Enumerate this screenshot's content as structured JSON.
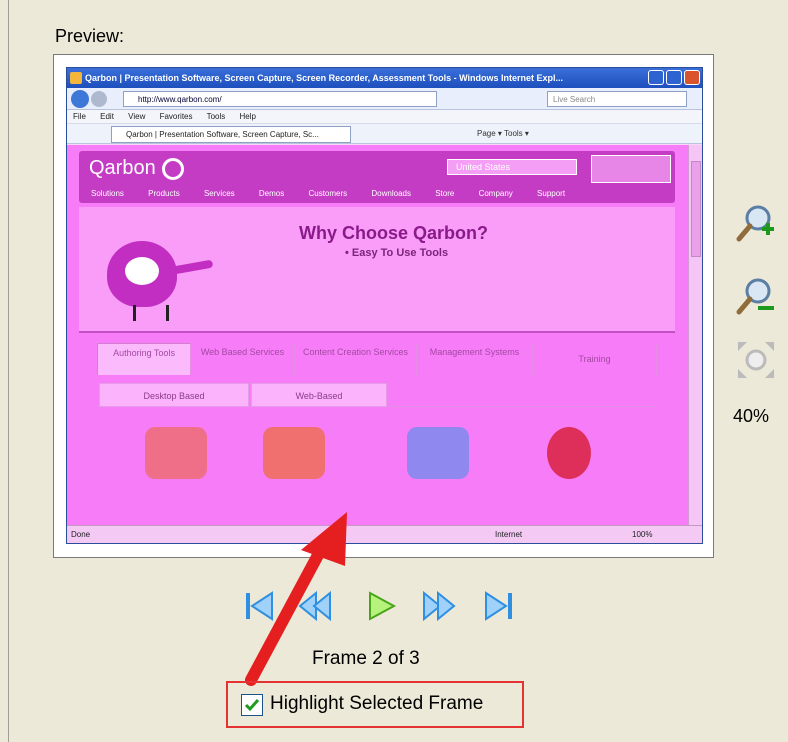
{
  "preview": {
    "label": "Preview:",
    "browser_title": "Qarbon | Presentation Software, Screen Capture, Screen Recorder, Assessment Tools - Windows Internet Expl...",
    "address": "http://www.qarbon.com/",
    "search_placeholder": "Live Search",
    "menu": [
      "File",
      "Edit",
      "View",
      "Favorites",
      "Tools",
      "Help"
    ],
    "tab_label": "Qarbon | Presentation Software, Screen Capture, Sc...",
    "toolbar_text": "Page ▾  Tools ▾",
    "site": {
      "logo": "Qarbon",
      "country": "United States",
      "nav": [
        "Solutions",
        "Products",
        "Services",
        "Demos",
        "Customers",
        "Downloads",
        "Store",
        "Company",
        "Support"
      ],
      "headline": "Why Choose Qarbon?",
      "bullet": "• Easy To Use Tools",
      "tabs": [
        "Authoring Tools",
        "Web Based Services",
        "Content Creation Services",
        "Management Systems",
        "Training"
      ],
      "subtabs": [
        "Desktop Based",
        "Web-Based"
      ]
    },
    "status_left": "Done",
    "status_zone": "Internet",
    "status_zoom": "100%",
    "colors": {
      "tile_1": "#f06f88",
      "tile_2": "#f07070",
      "tile_3": "#8f88ef",
      "tile_4": "#dd2f5a"
    }
  },
  "zoom": {
    "level": "40%",
    "zoom_in_icon": "magnifier-plus-icon",
    "zoom_out_icon": "magnifier-minus-icon",
    "fit_icon": "fit-to-window-icon"
  },
  "playback": {
    "frame_text": "Frame 2 of 3",
    "current_frame": 2,
    "total_frames": 3,
    "buttons": [
      "first-frame",
      "previous-frame",
      "play",
      "next-frame",
      "last-frame"
    ]
  },
  "highlight": {
    "label": "Highlight Selected Frame",
    "checked": true,
    "callout_color": "#e53232"
  }
}
